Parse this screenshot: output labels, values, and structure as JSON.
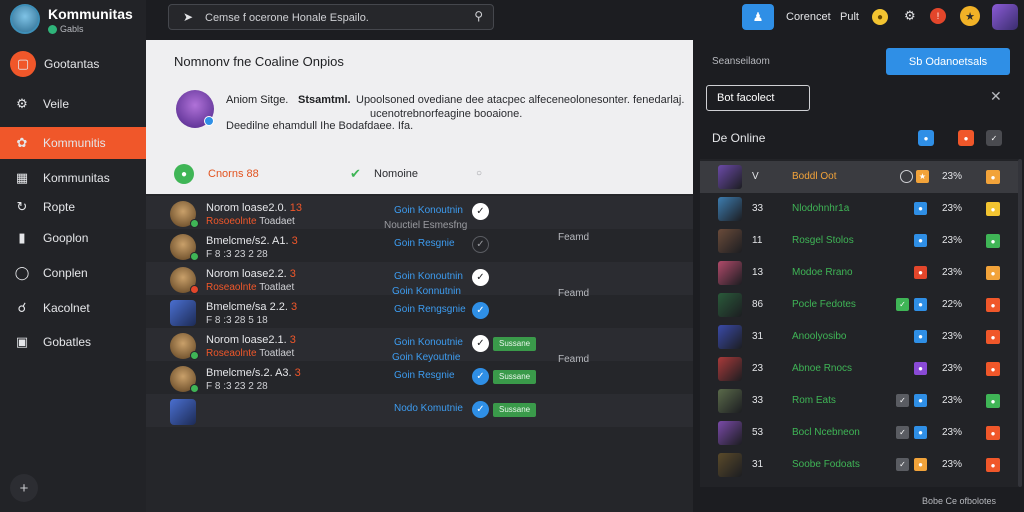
{
  "brand": {
    "title": "Kommunitas",
    "subtitle": "Gabls"
  },
  "search": {
    "placeholder": "Cemse f ocerone Honale Espailo."
  },
  "topbar": {
    "label1": "Corencet",
    "label2": "Pult"
  },
  "sidebar": {
    "items": [
      {
        "label": "Gootantas",
        "icon": "home-icon",
        "state": "top"
      },
      {
        "label": "Veile",
        "icon": "settings-icon",
        "state": "normal"
      },
      {
        "label": "Kommunitis",
        "icon": "community-icon",
        "state": "active"
      },
      {
        "label": "Kommunitas",
        "icon": "store-icon",
        "state": "normal"
      },
      {
        "label": "Ropte",
        "icon": "route-icon",
        "state": "normal"
      },
      {
        "label": "Gooplon",
        "icon": "bookmark-icon",
        "state": "normal"
      },
      {
        "label": "Conplen",
        "icon": "target-icon",
        "state": "normal"
      },
      {
        "label": "Kacolnet",
        "icon": "search-icon",
        "state": "normal"
      },
      {
        "label": "Gobatles",
        "icon": "folder-icon",
        "state": "normal"
      }
    ]
  },
  "header": {
    "title": "Nomnonv fne Coaline Onpios",
    "name": "Aniom Sitge.",
    "subtitle": "Stsamtml.",
    "desc1": "Upoolsoned ovediane dee atacpec alfeceneolonesonter. fenedarlaj.",
    "desc2": "ucenotrebnorfeagine booaione.",
    "desc3": "Deedilne ehamdull Ihe Bodafdaee. Ifa.",
    "online_label": "Cnorns 88",
    "verify_label": "Nomoine"
  },
  "friends": [
    {
      "name": "Norom loase2.0.",
      "num": "13",
      "status_prefix": "Rosoeolnte",
      "status": "Toadaet",
      "action": "Goin Konoutnin",
      "action2": "Nouctiel Esmesfng",
      "check": "white",
      "tag": "",
      "friend_label": "Feamd",
      "avatar": "round",
      "dot": "green",
      "shade": true
    },
    {
      "name": "Bmelcme/s2. A1.",
      "num": "3",
      "status_prefix": "",
      "status": "F 8 :3 23 2 28",
      "action": "Goin Resgnie",
      "action2": "",
      "check": "ring",
      "tag": "",
      "friend_label": "",
      "avatar": "round",
      "dot": "green",
      "shade": false
    },
    {
      "name": "Norom loase2.2.",
      "num": "3",
      "status_prefix": "Roseaolnte",
      "status": "Toatlaet",
      "action": "Goin Konoutnin",
      "action2": "Goin Konnutnin",
      "check": "white",
      "tag": "",
      "friend_label": "Feamd",
      "avatar": "round",
      "dot": "red",
      "shade": true
    },
    {
      "name": "Bmelcme/sa 2.2.",
      "num": "3",
      "status_prefix": "",
      "status": "F 8 :3 28 5 18",
      "action": "Goin Rengsgnie",
      "action2": "",
      "check": "blue",
      "tag": "",
      "friend_label": "",
      "avatar": "square",
      "dot": "",
      "shade": false
    },
    {
      "name": "Norom loase2.1.",
      "num": "3",
      "status_prefix": "Roseaolnte",
      "status": "Toatlaet",
      "action": "Goin Konoutnie",
      "action2": "Goin Keyoutnie",
      "check": "white",
      "tag": "Sussane",
      "friend_label": "Feamd",
      "avatar": "round",
      "dot": "green",
      "shade": true
    },
    {
      "name": "Bmelcme/s.2. A3.",
      "num": "3",
      "status_prefix": "",
      "status": "F 8 :3 23 2 28",
      "action": "Goin Resgnie",
      "action2": "",
      "check": "blue",
      "tag": "Sussane",
      "friend_label": "",
      "avatar": "round",
      "dot": "green",
      "shade": false
    },
    {
      "name": "",
      "num": "",
      "status_prefix": "",
      "status": "",
      "action": "Nodo Komutnie",
      "action2": "",
      "check": "blue",
      "tag": "Sussane",
      "friend_label": "",
      "avatar": "square",
      "dot": "",
      "shade": true
    }
  ],
  "right_panel": {
    "title": "Seanseilaom",
    "button_label": "Sb Odanoetsals",
    "search_value": "Bot facolect",
    "online_title": "De Online",
    "rows": [
      {
        "rank": "V",
        "name": "Boddl Oot",
        "name_color": "orange",
        "value": "23%",
        "thumb": "#6b4aa8",
        "badge": "#f2a33a",
        "active": true
      },
      {
        "rank": "33",
        "name": "Nlodohnhr1a",
        "name_color": "green",
        "value": "23%",
        "thumb": "#3d7db0",
        "badge": "#f2c431",
        "active": false
      },
      {
        "rank": "11",
        "name": "Rosgel Stolos",
        "name_color": "green",
        "value": "23%",
        "thumb": "#6a4b3a",
        "badge": "#3fb556",
        "active": false
      },
      {
        "rank": "13",
        "name": "Modoe Rrano",
        "name_color": "green",
        "value": "23%",
        "thumb": "#b04a6a",
        "badge": "#f2a33a",
        "active": false
      },
      {
        "rank": "86",
        "name": "Pocle Fedotes",
        "name_color": "green",
        "value": "22%",
        "thumb": "#2a5a3a",
        "badge": "#f0572a",
        "active": false
      },
      {
        "rank": "31",
        "name": "Anoolyosibo",
        "name_color": "green",
        "value": "23%",
        "thumb": "#3a4aa8",
        "badge": "#f0572a",
        "active": false
      },
      {
        "rank": "23",
        "name": "Abnoe Rnocs",
        "name_color": "green",
        "value": "23%",
        "thumb": "#a83a3a",
        "badge": "#f0572a",
        "active": false
      },
      {
        "rank": "33",
        "name": "Rom Eats",
        "name_color": "green",
        "value": "23%",
        "thumb": "#5a6a4a",
        "badge": "#3fb556",
        "active": false
      },
      {
        "rank": "53",
        "name": "Bocl Ncebneon",
        "name_color": "green",
        "value": "23%",
        "thumb": "#7a4aa8",
        "badge": "#f0572a",
        "active": false
      },
      {
        "rank": "31",
        "name": "Soobe Fodoats",
        "name_color": "green",
        "value": "23%",
        "thumb": "#5a4a2a",
        "badge": "#f0572a",
        "active": false
      }
    ]
  },
  "footer": "Bobe Ce  ofbolotes"
}
